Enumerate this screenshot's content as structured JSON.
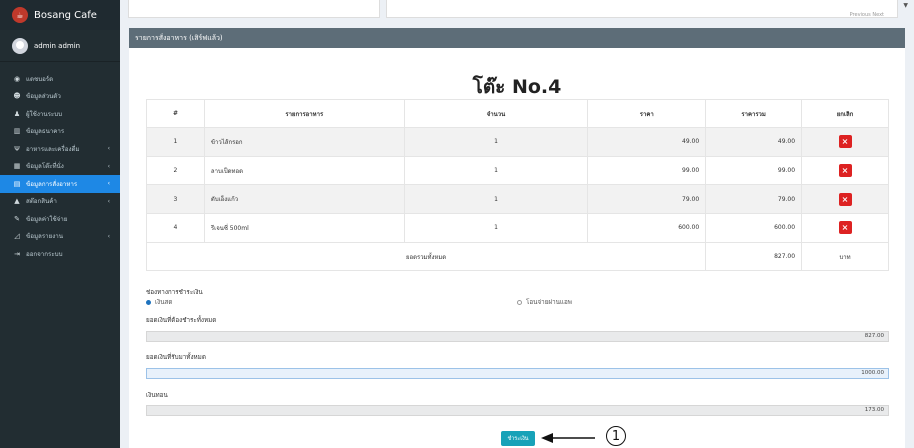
{
  "app": {
    "name": "Bosang Cafe",
    "logo": "cafe-logo-icon",
    "user": "admin admin"
  },
  "sidebar": {
    "items": [
      {
        "label": "แดชบอร์ด",
        "icon": "dashboard-icon",
        "chevron": false,
        "active": false
      },
      {
        "label": "ข้อมูลส่วนตัว",
        "icon": "user-icon",
        "chevron": false,
        "active": false
      },
      {
        "label": "ผู้ใช้งานระบบ",
        "icon": "users-icon",
        "chevron": false,
        "active": false
      },
      {
        "label": "ข้อมูลธนาคาร",
        "icon": "bank-icon",
        "chevron": false,
        "active": false
      },
      {
        "label": "อาหารและเครื่องดื่ม",
        "icon": "food-icon",
        "chevron": true,
        "active": false
      },
      {
        "label": "ข้อมูลโต๊ะที่นั่ง",
        "icon": "table-icon",
        "chevron": true,
        "active": false
      },
      {
        "label": "ข้อมูลการสั่งอาหาร",
        "icon": "order-icon",
        "chevron": true,
        "active": true
      },
      {
        "label": "สต๊อกสินค้า",
        "icon": "stock-icon",
        "chevron": true,
        "active": false
      },
      {
        "label": "ข้อมูลค่าใช้จ่าย",
        "icon": "expense-icon",
        "chevron": false,
        "active": false
      },
      {
        "label": "ข้อมูลรายงาน",
        "icon": "report-icon",
        "chevron": true,
        "active": false
      },
      {
        "label": "ออกจากระบบ",
        "icon": "logout-icon",
        "chevron": false,
        "active": false
      }
    ]
  },
  "topbar": {
    "pager": "Previous    Next"
  },
  "panel": {
    "title": "รายการสั่งอาหาร (เสิร์ฟแล้ว)",
    "table_title": "โต๊ะ No.4"
  },
  "table": {
    "headers": [
      "#",
      "รายการอาหาร",
      "จำนวน",
      "ราคา",
      "ราคารวม",
      "ยกเลิก"
    ],
    "rows": [
      {
        "no": "1",
        "item": "ข้าวไส้กรอก",
        "qty": "1",
        "price": "49.00",
        "total": "49.00"
      },
      {
        "no": "2",
        "item": "ลาบเป็ดทอด",
        "qty": "1",
        "price": "99.00",
        "total": "99.00"
      },
      {
        "no": "3",
        "item": "ตับเอ็งแก้ว",
        "qty": "1",
        "price": "79.00",
        "total": "79.00"
      },
      {
        "no": "4",
        "item": "รีเจนซี่ 500ml",
        "qty": "1",
        "price": "600.00",
        "total": "600.00"
      }
    ],
    "total_label": "ยอดรวมทั้งหมด",
    "total_value": "827.00",
    "currency": "บาท"
  },
  "payment": {
    "channel_label": "ช่องทางการชำระเงิน",
    "opt_cash": "เงินสด",
    "opt_transfer": "โอนจ่ายผ่านแอพ",
    "due_label": "ยอดเงินที่ต้องชำระทั้งหมด",
    "due_value": "827.00",
    "received_label": "ยอดเงินที่รับมาทั้งหมด",
    "received_value": "1000.00",
    "change_label": "เงินทอน",
    "change_value": "173.00",
    "button": "ชำระเงิน"
  },
  "annotation": {
    "number": "1"
  }
}
